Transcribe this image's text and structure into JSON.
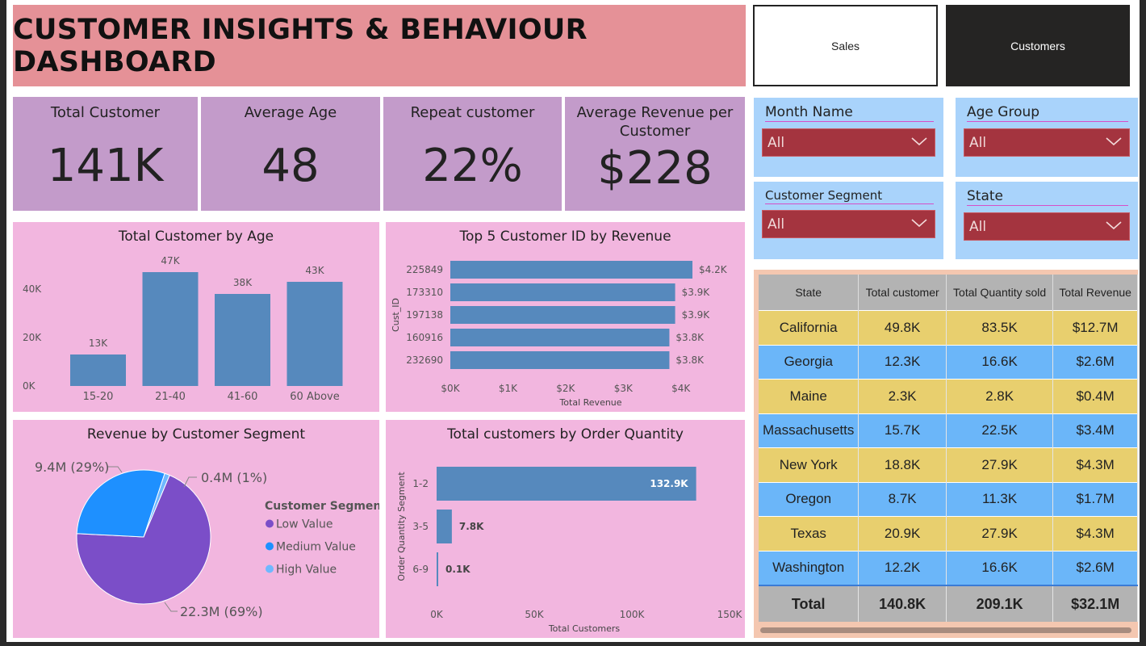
{
  "title": "CUSTOMER INSIGHTS & BEHAVIOUR DASHBOARD",
  "nav": {
    "sales": "Sales",
    "customers": "Customers"
  },
  "kpis": [
    {
      "label": "Total Customer",
      "value": "141K"
    },
    {
      "label": "Average Age",
      "value": "48"
    },
    {
      "label": "Repeat customer",
      "value": "22%"
    },
    {
      "label": "Average Revenue per Customer",
      "value": "$228"
    }
  ],
  "slicers": [
    {
      "label": "Month Name",
      "value": "All"
    },
    {
      "label": "Age Group",
      "value": "All"
    },
    {
      "label": "Customer Segment",
      "value": "All"
    },
    {
      "label": "State",
      "value": "All"
    }
  ],
  "table": {
    "headers": [
      "State",
      "Total customer",
      "Total Quantity sold",
      "Total Revenue"
    ],
    "rows": [
      [
        "California",
        "49.8K",
        "83.5K",
        "$12.7M"
      ],
      [
        "Georgia",
        "12.3K",
        "16.6K",
        "$2.6M"
      ],
      [
        "Maine",
        "2.3K",
        "2.8K",
        "$0.4M"
      ],
      [
        "Massachusetts",
        "15.7K",
        "22.5K",
        "$3.4M"
      ],
      [
        "New York",
        "18.8K",
        "27.9K",
        "$4.3M"
      ],
      [
        "Oregon",
        "8.7K",
        "11.3K",
        "$1.7M"
      ],
      [
        "Texas",
        "20.9K",
        "27.9K",
        "$4.3M"
      ],
      [
        "Washington",
        "12.2K",
        "16.6K",
        "$2.6M"
      ]
    ],
    "total": [
      "Total",
      "140.8K",
      "209.1K",
      "$32.1M"
    ]
  },
  "colors": {
    "bar": "#5689bd",
    "low": "#7b4ec8",
    "medium": "#1e90ff",
    "high": "#6fb8ff"
  },
  "chart_data": [
    {
      "type": "bar",
      "title": "Total Customer by Age",
      "categories": [
        "15-20",
        "21-40",
        "41-60",
        "60 Above"
      ],
      "values": [
        13,
        47,
        38,
        43
      ],
      "data_labels": [
        "13K",
        "47K",
        "38K",
        "43K"
      ],
      "y_ticks": [
        "0K",
        "20K",
        "40K"
      ],
      "ylim": [
        0,
        47
      ],
      "grid": false
    },
    {
      "type": "bar",
      "orientation": "horizontal",
      "title": "Top 5 Customer ID by Revenue",
      "categories": [
        "225849",
        "173310",
        "197138",
        "160916",
        "232690"
      ],
      "values": [
        4.2,
        3.9,
        3.9,
        3.8,
        3.8
      ],
      "data_labels": [
        "$4.2K",
        "$3.9K",
        "$3.9K",
        "$3.8K",
        "$3.8K"
      ],
      "x_ticks": [
        "$0K",
        "$1K",
        "$2K",
        "$3K",
        "$4K"
      ],
      "xlabel": "Total Revenue",
      "ylabel": "Cust_ID",
      "xlim": [
        0,
        4.2
      ]
    },
    {
      "type": "pie",
      "title": "Revenue by Customer Segment",
      "legend_title": "Customer Segment",
      "legend_position": "right",
      "slices": [
        {
          "name": "Low Value",
          "value": 22.3,
          "label": "22.3M (69%)"
        },
        {
          "name": "Medium Value",
          "value": 9.4,
          "label": "9.4M (29%)"
        },
        {
          "name": "High Value",
          "value": 0.4,
          "label": "0.4M (1%)"
        }
      ]
    },
    {
      "type": "bar",
      "orientation": "horizontal",
      "title": "Total customers by Order Quantity",
      "categories": [
        "1-2",
        "3-5",
        "6-9"
      ],
      "values": [
        132.9,
        7.8,
        0.1
      ],
      "data_labels": [
        "132.9K",
        "7.8K",
        "0.1K"
      ],
      "x_ticks": [
        "0K",
        "50K",
        "100K",
        "150K"
      ],
      "xlabel": "Total Customers",
      "ylabel": "Order Quantity Segment",
      "xlim": [
        0,
        150
      ]
    }
  ]
}
